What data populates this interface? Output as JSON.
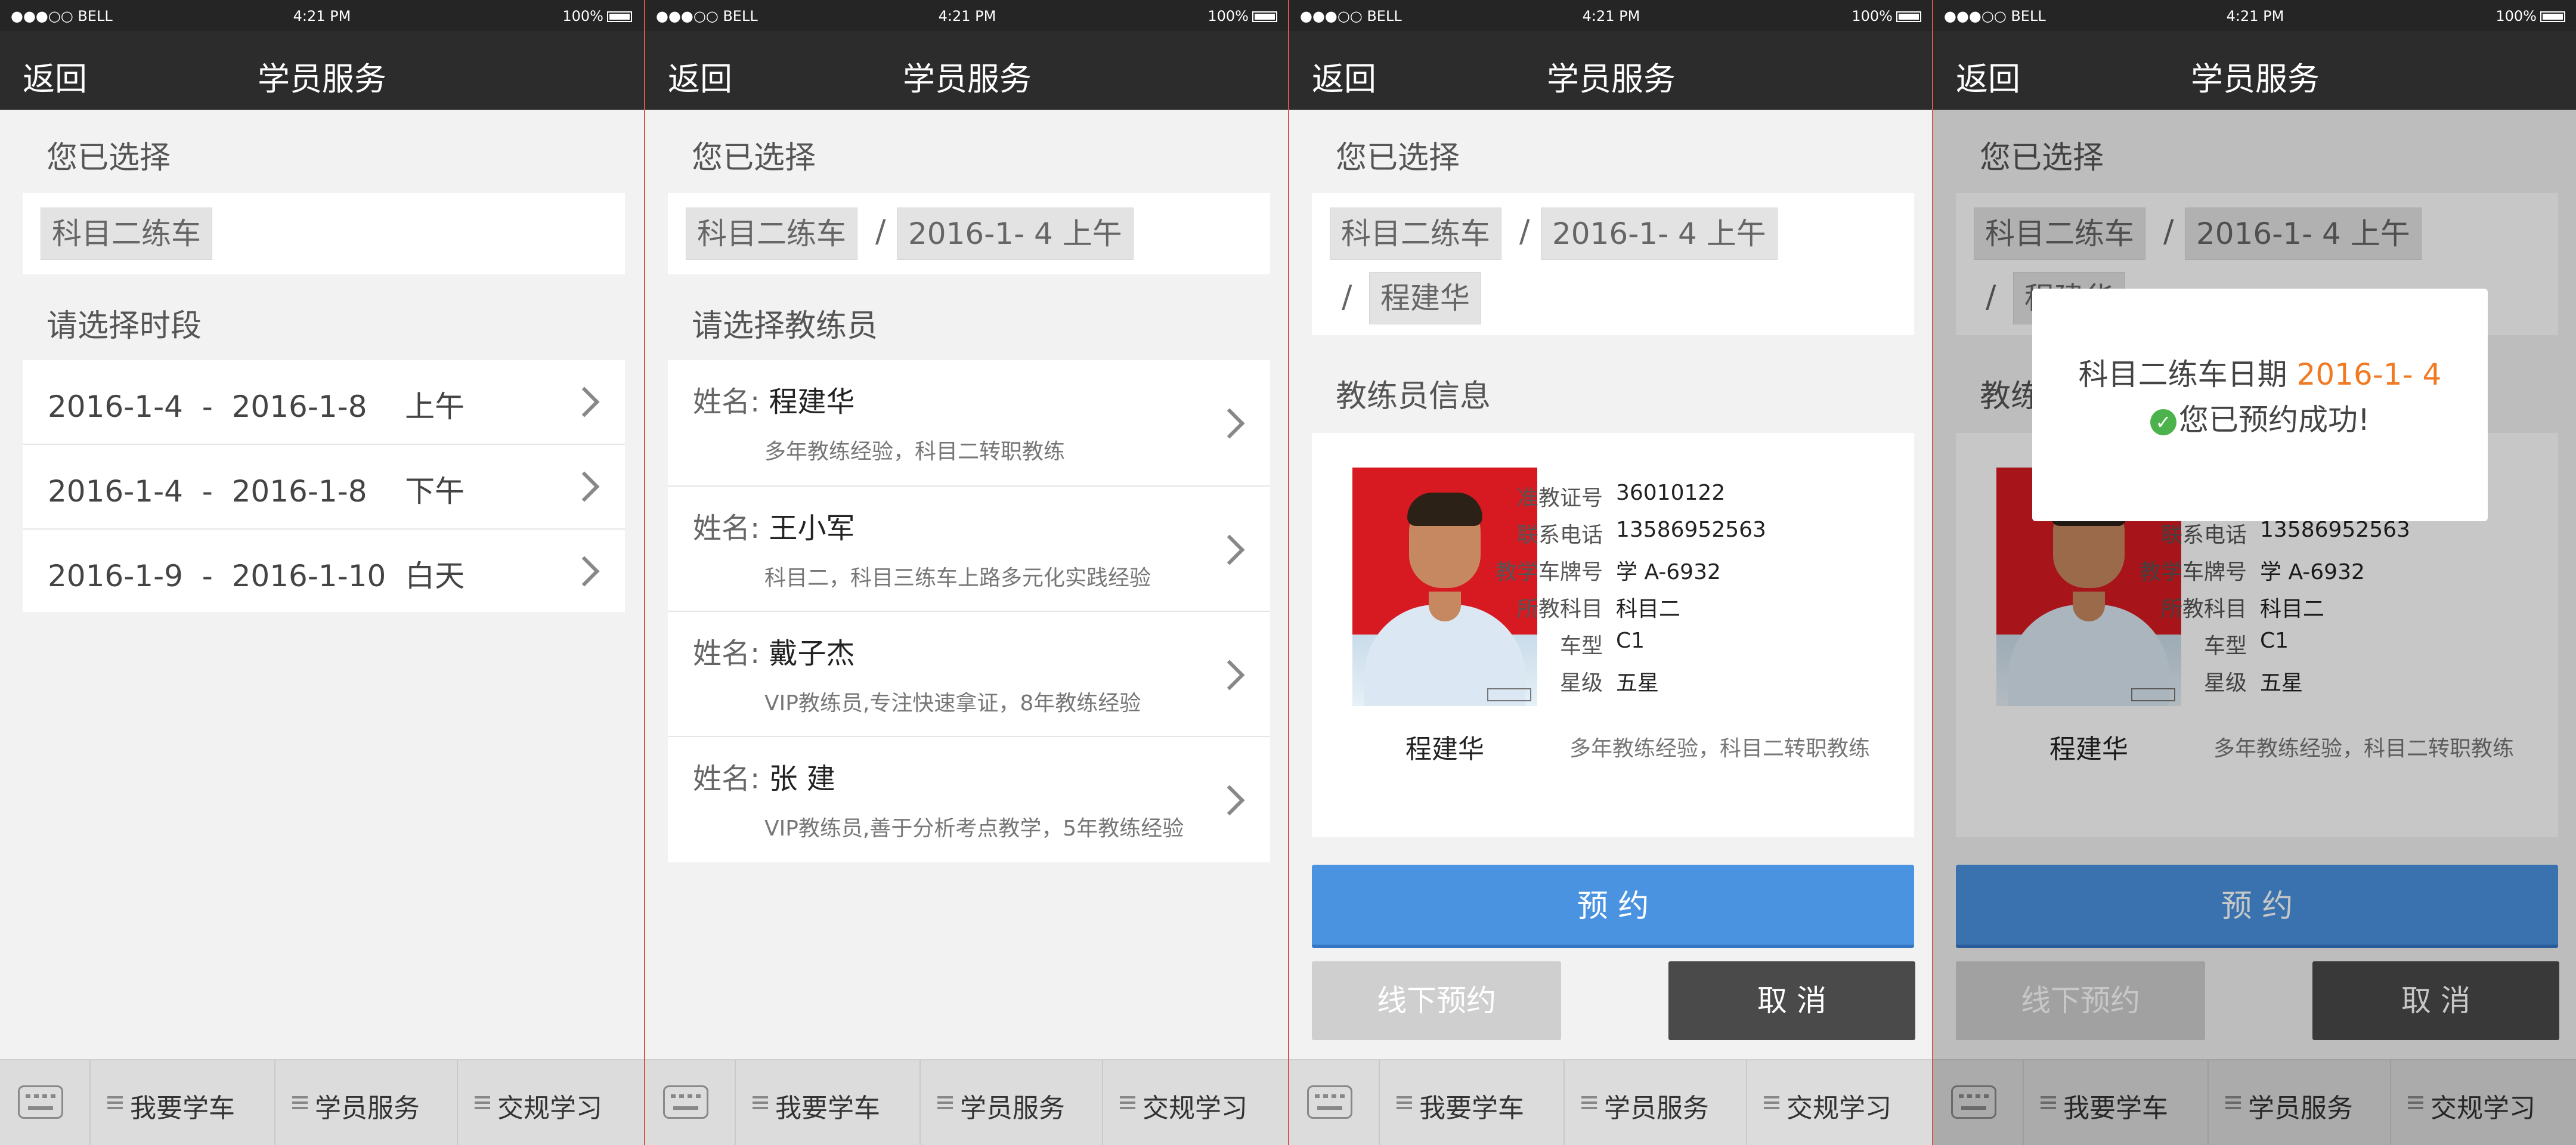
{
  "status": {
    "carrier": "●●●○○ BELL",
    "time": "4:21 PM",
    "battery": "100%"
  },
  "nav": {
    "back": "返回",
    "title": "学员服务"
  },
  "tabs": {
    "items": [
      "我要学车",
      "学员服务",
      "交规学习"
    ]
  },
  "screen1": {
    "selected_title": "您已选择",
    "chip_subject": "科目二练车",
    "period_title": "请选择时段",
    "periods": [
      "2016-1-4  -  2016-1-8    上午",
      "2016-1-4  -  2016-1-8    下午",
      "2016-1-9  -  2016-1-10  白天"
    ]
  },
  "screen2": {
    "selected_title": "您已选择",
    "chip_subject": "科目二练车",
    "slash": "/",
    "chip_date": "2016-1- 4  上午",
    "coach_title": "请选择教练员",
    "name_label": "姓名:",
    "coaches": [
      {
        "name": "程建华",
        "desc": "多年教练经验，科目二转职教练"
      },
      {
        "name": "王小军",
        "desc": "科目二，科目三练车上路多元化实践经验"
      },
      {
        "name": "戴子杰",
        "desc": "VIP教练员,专注快速拿证，8年教练经验"
      },
      {
        "name": "张 建",
        "desc": "VIP教练员,善于分析考点教学，5年教练经验"
      }
    ]
  },
  "screen3": {
    "selected_title": "您已选择",
    "chip_subject": "科目二练车",
    "slash": "/",
    "chip_date": "2016-1- 4  上午",
    "chip_coach": "程建华",
    "info_title": "教练员信息",
    "photo_name": "程建华",
    "info": [
      {
        "k": "准教证号",
        "v": "36010122"
      },
      {
        "k": "联系电话",
        "v": "13586952563"
      },
      {
        "k": "教学车牌号",
        "v": "学 A-6932"
      },
      {
        "k": "所教科目",
        "v": "科目二"
      },
      {
        "k": "车型",
        "v": "C1"
      },
      {
        "k": "星级",
        "v": "五星"
      }
    ],
    "desc": "多年教练经验，科目二转职教练",
    "book": "预 约",
    "offline": "线下预约",
    "cancel": "取 消"
  },
  "screen4": {
    "dialog_line1": "科目二练车日期",
    "dialog_date": "2016-1- 4",
    "dialog_check": "✓",
    "dialog_line2": "您已预约成功!",
    "partial_chip": "程建华",
    "partial_title": "教练"
  },
  "colors": {
    "primary": "#4a93e0",
    "accent": "#f07a24",
    "success": "#4cb24c",
    "nav": "#2c2c2c"
  }
}
